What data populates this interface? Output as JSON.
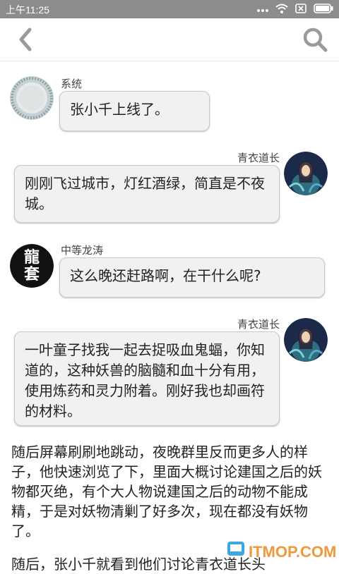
{
  "status_bar": {
    "time": "上午11:25",
    "icons": [
      "dots-icon",
      "wifi-icon",
      "sim-icon",
      "battery-icon"
    ]
  },
  "top_bar": {
    "back_icon": "chevron-left-icon",
    "search_icon": "search-icon"
  },
  "messages": [
    {
      "sender": "系统",
      "text": "张小千上线了。",
      "side": "left",
      "avatar": "mirror-avatar"
    },
    {
      "sender": "青衣道长",
      "text": "刚刚飞过城市，灯红酒绿，简直是不夜城。",
      "side": "right",
      "avatar": "taoist-avatar"
    },
    {
      "sender": "中等龙涛",
      "text": "这么晚还赶路啊，在干什么呢?",
      "side": "left",
      "avatar": "dragon-avatar"
    },
    {
      "sender": "青衣道长",
      "text": "一叶童子找我一起去捉吸血鬼蝠，你知道的，这种妖兽的脑髓和血十分有用，使用炼药和灵力附着。刚好我也却画符的材料。",
      "side": "right",
      "avatar": "taoist-avatar"
    }
  ],
  "avatar_glyphs": {
    "dragon": "龍套"
  },
  "narration": "随后屏幕刷刷地跳动，夜晚群里反而更多人的样子，他快速浏览了下，里面大概讨论建国之后的妖物都灭绝，有个大人物说建国之后的动物不能成精，于是对妖物清剿了好多次，现在都没有妖物了。",
  "narration_next": "随后，张小千就看到他们讨论青衣道长头",
  "watermark": "ITMOP.COM"
}
